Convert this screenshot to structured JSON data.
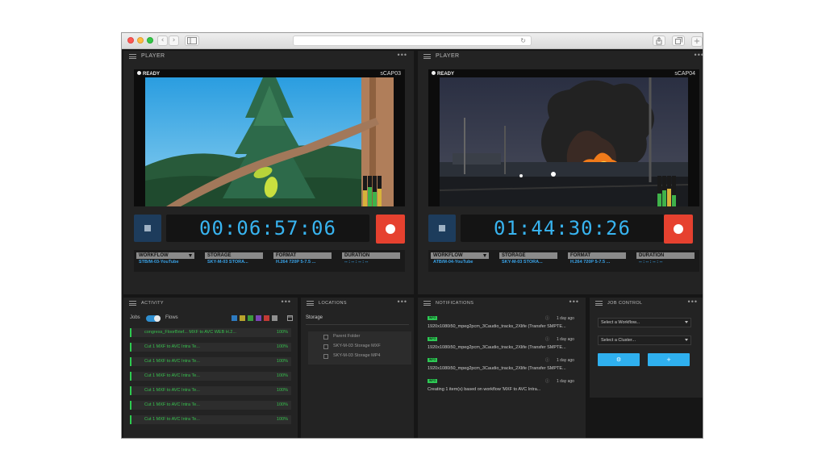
{
  "browser": {
    "back_glyph": "‹",
    "forward_glyph": "›",
    "reload_glyph": "↻"
  },
  "players": [
    {
      "title": "PLAYER",
      "status": "READY",
      "channel": "sCAP03",
      "timecode": "00:06:57:06",
      "fields": [
        {
          "label": "WORKFLOW",
          "value": "STB/M-03-YouTube"
        },
        {
          "label": "STORAGE",
          "value": "SKY-M-03 STORA..."
        },
        {
          "label": "FORMAT",
          "value": "H.264 720P 5-7.5 ..."
        },
        {
          "label": "DURATION",
          "value": "-- : -- : -- : --"
        }
      ]
    },
    {
      "title": "PLAYER",
      "status": "READY",
      "channel": "sCAP04",
      "timecode": "01:44:30:26",
      "fields": [
        {
          "label": "WORKFLOW",
          "value": "ATB/M-04-YouTube"
        },
        {
          "label": "STORAGE",
          "value": "SKY-M-03 STORA..."
        },
        {
          "label": "FORMAT",
          "value": "H.264 720P 5-7.5 ..."
        },
        {
          "label": "DURATION",
          "value": "-- : -- : -- : --"
        }
      ]
    }
  ],
  "activity": {
    "title": "ACTIVITY",
    "jobs_label": "Jobs",
    "flows_label": "Flows",
    "filter_colors": [
      "#2d7ac0",
      "#b8a32c",
      "#3a9a3c",
      "#7a45b5",
      "#c23a35",
      "#909090"
    ],
    "rows": [
      {
        "label": "congress_FloorBrief... MXF to AVC WEB H.2...",
        "pct": "100%"
      },
      {
        "label": "Cut 1   MXF to AVC Intra Te...",
        "pct": "100%"
      },
      {
        "label": "Cut 1   MXF to AVC Intra Te...",
        "pct": "100%"
      },
      {
        "label": "Cut 1   MXF to AVC Intra Te...",
        "pct": "100%"
      },
      {
        "label": "Cut 1   MXF to AVC Intra Te...",
        "pct": "100%"
      },
      {
        "label": "Cut 1   MXF to AVC Intra Te...",
        "pct": "100%"
      },
      {
        "label": "Cut 1   MXF to AVC Intra Te...",
        "pct": "100%"
      }
    ]
  },
  "locations": {
    "title": "LOCATIONS",
    "group": "Storage",
    "items": [
      "Parent Folder",
      "SKY-M-03 Storage MXF",
      "SKY-M-03 Storage MP4"
    ]
  },
  "notifications": {
    "title": "NOTIFICATIONS",
    "badge": "INFO",
    "items": [
      {
        "time": "1 day ago",
        "text": "1920x1080i50_mpeg2pcm_3Caudio_tracks_2Xlife (Transfer SMPTE..."
      },
      {
        "time": "1 day ago",
        "text": "1920x1080i50_mpeg2pcm_3Caudio_tracks_2Xlife (Transfer SMPTE..."
      },
      {
        "time": "1 day ago",
        "text": "1920x1080i50_mpeg2pcm_3Caudio_tracks_2Xlife (Transfer SMPTE..."
      },
      {
        "time": "1 day ago",
        "text": "Creating 1 item(s) based on workflow 'MXF to AVC Intra..."
      }
    ]
  },
  "job_control": {
    "title": "JOB CONTROL",
    "workflow_placeholder": "Select a Workflow...",
    "cluster_placeholder": "Select a Cluster...",
    "gear_glyph": "⚙",
    "add_glyph": "+"
  }
}
